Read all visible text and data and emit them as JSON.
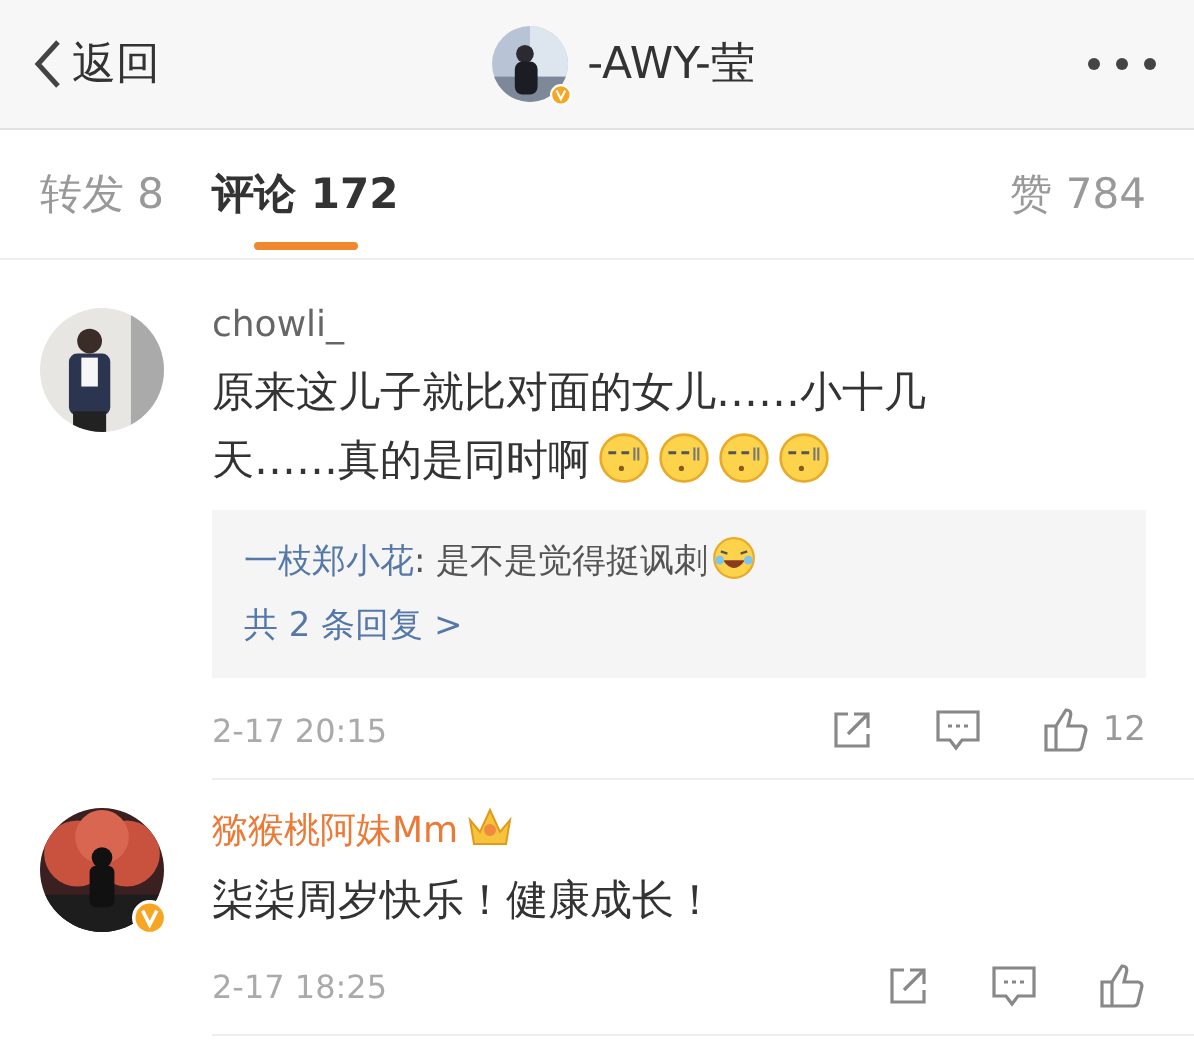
{
  "header": {
    "back_label": "返回",
    "title": "-AWY-莹",
    "verified": true
  },
  "tabs": [
    {
      "label": "转发 8",
      "selected": false
    },
    {
      "label": "评论 172",
      "selected": true
    },
    {
      "label": "赞 784",
      "selected": false
    }
  ],
  "comments": [
    {
      "author": "chowli_",
      "vip": false,
      "verified": false,
      "text": "原来这儿子就比对面的女儿……小十几天……真的是同时啊",
      "emojis": [
        {
          "kind": "sleepy"
        },
        {
          "kind": "sleepy"
        },
        {
          "kind": "sleepy"
        },
        {
          "kind": "sleepy"
        }
      ],
      "replies": {
        "items": [
          {
            "author": "一枝郑小花",
            "text": ": 是不是觉得挺讽刺",
            "emoji": {
              "kind": "laugh"
            }
          }
        ],
        "more": "共 2 条回复 >"
      },
      "time": "2-17 20:15",
      "likes": "12"
    },
    {
      "author": "猕猴桃阿妹Mm",
      "vip": true,
      "verified": true,
      "text": "柒柒周岁快乐！健康成长！",
      "time": "2-17 18:25"
    }
  ]
}
